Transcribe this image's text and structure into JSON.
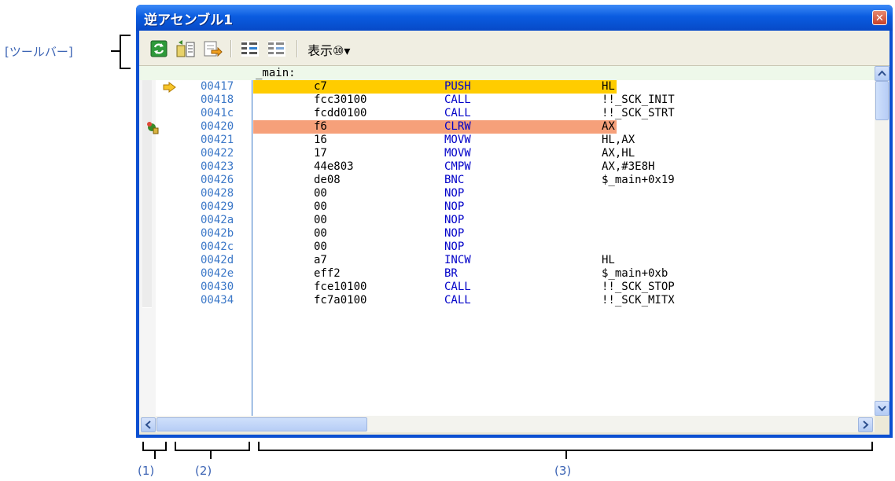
{
  "annotations": {
    "toolbar_label": "[ツールバー]",
    "col1": "(1)",
    "col2": "(2)",
    "col3": "(3)"
  },
  "window": {
    "title": "逆アセンブル1",
    "close_glyph": "✕"
  },
  "toolbar": {
    "buttons": [
      "refresh-icon",
      "save-icon",
      "export-icon",
      "step-icon",
      "run-icon"
    ],
    "view_menu": "表示⑩▾"
  },
  "disasm": {
    "label": "_main:",
    "rows": [
      {
        "addr": "00417",
        "code": "c7",
        "mnemonic": "PUSH",
        "operand": "HL",
        "highlight": "current"
      },
      {
        "addr": "00418",
        "code": "fcc30100",
        "mnemonic": "CALL",
        "operand": "!!_SCK_INIT"
      },
      {
        "addr": "0041c",
        "code": "fcdd0100",
        "mnemonic": "CALL",
        "operand": "!!_SCK_STRT"
      },
      {
        "addr": "00420",
        "code": "f6",
        "mnemonic": "CLRW",
        "operand": "AX",
        "highlight": "break"
      },
      {
        "addr": "00421",
        "code": "16",
        "mnemonic": "MOVW",
        "operand": "HL,AX"
      },
      {
        "addr": "00422",
        "code": "17",
        "mnemonic": "MOVW",
        "operand": "AX,HL"
      },
      {
        "addr": "00423",
        "code": "44e803",
        "mnemonic": "CMPW",
        "operand": "AX,#3E8H"
      },
      {
        "addr": "00426",
        "code": "de08",
        "mnemonic": "BNC",
        "operand": "$_main+0x19"
      },
      {
        "addr": "00428",
        "code": "00",
        "mnemonic": "NOP",
        "operand": ""
      },
      {
        "addr": "00429",
        "code": "00",
        "mnemonic": "NOP",
        "operand": ""
      },
      {
        "addr": "0042a",
        "code": "00",
        "mnemonic": "NOP",
        "operand": ""
      },
      {
        "addr": "0042b",
        "code": "00",
        "mnemonic": "NOP",
        "operand": ""
      },
      {
        "addr": "0042c",
        "code": "00",
        "mnemonic": "NOP",
        "operand": ""
      },
      {
        "addr": "0042d",
        "code": "a7",
        "mnemonic": "INCW",
        "operand": "HL"
      },
      {
        "addr": "0042e",
        "code": "eff2",
        "mnemonic": "BR",
        "operand": "$_main+0xb"
      },
      {
        "addr": "00430",
        "code": "fce10100",
        "mnemonic": "CALL",
        "operand": "!!_SCK_STOP"
      },
      {
        "addr": "00434",
        "code": "fc7a0100",
        "mnemonic": "CALL",
        "operand": "!!_SCK_MITX"
      }
    ]
  },
  "colors": {
    "current_pc": "#ffcc00",
    "breakpoint": "#f6a07a",
    "address": "#3c78c8",
    "mnemonic": "#0000c8",
    "title_bar": "#0a5ce0"
  }
}
